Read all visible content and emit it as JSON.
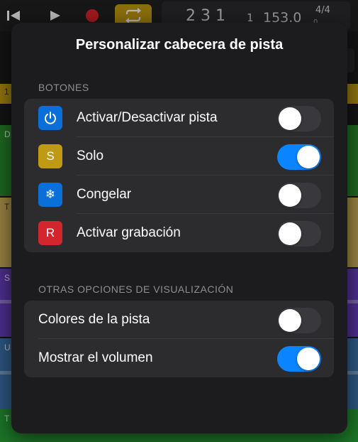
{
  "colors": {
    "accent_blue": "#0a84ff",
    "power_icon_bg": "#0a6fd8",
    "solo_icon_bg": "#bf9a14",
    "freeze_icon_bg": "#0a6fd8",
    "record_icon_bg": "#d2262f",
    "cycle_button": "#c39a11"
  },
  "background": {
    "lcd": {
      "bar": "2 3 1",
      "beat2": "1",
      "tempo": "153.0",
      "signature": "4/4",
      "subline": "0 ..."
    },
    "ruler_label": "1",
    "tracks": [
      "D",
      "T",
      "S",
      "U",
      "T"
    ]
  },
  "popover": {
    "title": "Personalizar cabecera de pista",
    "sections": {
      "buttons": {
        "header": "BOTONES",
        "items": [
          {
            "label": "Activar/Desactivar pista",
            "icon": "power-icon",
            "on": false
          },
          {
            "label": "Solo",
            "icon": "solo-icon",
            "glyph": "S",
            "on": true
          },
          {
            "label": "Congelar",
            "icon": "snowflake-icon",
            "glyph": "❄",
            "on": false
          },
          {
            "label": "Activar grabación",
            "icon": "record-enable-icon",
            "glyph": "R",
            "on": false
          }
        ]
      },
      "display": {
        "header": "OTRAS OPCIONES DE VISUALIZACIÓN",
        "items": [
          {
            "label": "Colores de la pista",
            "on": false
          },
          {
            "label": "Mostrar el volumen",
            "on": true
          }
        ]
      }
    }
  }
}
